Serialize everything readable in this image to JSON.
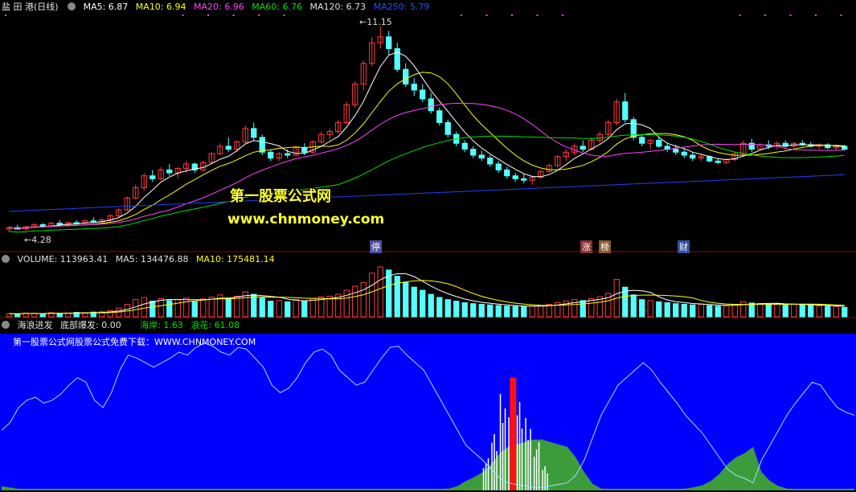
{
  "price_header": {
    "stock": "盐 田 港(日线)",
    "ma5": "MA5: 6.87",
    "ma10": "MA10: 6.94",
    "ma20": "MA20: 6.96",
    "ma60": "MA60: 6.76",
    "ma120": "MA120: 6.73",
    "ma250": "MA250: 5.79"
  },
  "price_labels": {
    "high": "11.15",
    "low": "4.28"
  },
  "event_tags": [
    "停",
    "涨",
    "榜",
    "财"
  ],
  "watermark": {
    "name": "第一股票公式网",
    "url": "www.chnmoney.com"
  },
  "volume_header": {
    "volume": "VOLUME: 113963.41",
    "ma5": "MA5: 134476.88",
    "ma10": "MA10: 175481.14"
  },
  "indicator_header": {
    "name": "海浪进发",
    "bottom": "底部爆发: 0.00",
    "coast": "海岸: 1.63",
    "wave": "浪花: 61.08"
  },
  "indicator_banner": "第一股票公式网股票公式免费下载：WWW.CHNMONEY.COM",
  "colors": {
    "up": "#ff3c3c",
    "down": "#54ffff",
    "ma5": "#ffffff",
    "ma10": "#ffff00",
    "ma20": "#ff40ff",
    "ma60": "#00e000",
    "ma250": "#2040ff",
    "ind_bg": "#0000ff",
    "wave": "#3c9c3c",
    "bottom": "#ff1010"
  },
  "chart_data": [
    {
      "type": "candlestick",
      "series": "daily price",
      "ylim": [
        4.0,
        11.5
      ],
      "high_marker": 11.15,
      "low_marker": 4.28,
      "ohlc": [
        [
          4.3,
          4.4,
          4.2,
          4.35
        ],
        [
          4.35,
          4.45,
          4.28,
          4.3
        ],
        [
          4.3,
          4.4,
          4.25,
          4.38
        ],
        [
          4.38,
          4.5,
          4.3,
          4.45
        ],
        [
          4.45,
          4.5,
          4.35,
          4.4
        ],
        [
          4.4,
          4.55,
          4.35,
          4.5
        ],
        [
          4.5,
          4.6,
          4.4,
          4.45
        ],
        [
          4.45,
          4.55,
          4.38,
          4.52
        ],
        [
          4.52,
          4.6,
          4.45,
          4.5
        ],
        [
          4.5,
          4.62,
          4.45,
          4.58
        ],
        [
          4.58,
          4.7,
          4.5,
          4.55
        ],
        [
          4.55,
          4.65,
          4.5,
          4.62
        ],
        [
          4.62,
          4.8,
          4.55,
          4.75
        ],
        [
          4.75,
          5.0,
          4.7,
          4.95
        ],
        [
          4.95,
          5.4,
          4.9,
          5.35
        ],
        [
          5.35,
          5.8,
          5.3,
          5.7
        ],
        [
          5.7,
          6.2,
          5.6,
          6.1
        ],
        [
          6.1,
          6.3,
          5.9,
          6.0
        ],
        [
          6.0,
          6.4,
          5.95,
          6.3
        ],
        [
          6.3,
          6.5,
          6.1,
          6.2
        ],
        [
          6.2,
          6.4,
          6.0,
          6.35
        ],
        [
          6.35,
          6.6,
          6.2,
          6.5
        ],
        [
          6.5,
          6.55,
          6.2,
          6.3
        ],
        [
          6.3,
          6.6,
          6.25,
          6.55
        ],
        [
          6.55,
          6.9,
          6.5,
          6.85
        ],
        [
          6.85,
          7.2,
          6.8,
          7.1
        ],
        [
          7.1,
          7.4,
          6.9,
          7.0
        ],
        [
          7.0,
          7.3,
          6.9,
          7.25
        ],
        [
          7.25,
          7.8,
          7.2,
          7.7
        ],
        [
          7.7,
          7.9,
          7.3,
          7.4
        ],
        [
          7.4,
          7.5,
          6.8,
          6.9
        ],
        [
          6.9,
          7.0,
          6.6,
          6.7
        ],
        [
          6.7,
          6.9,
          6.6,
          6.85
        ],
        [
          6.85,
          7.0,
          6.7,
          6.8
        ],
        [
          6.8,
          7.1,
          6.75,
          7.05
        ],
        [
          7.05,
          7.2,
          6.8,
          6.9
        ],
        [
          6.9,
          7.3,
          6.85,
          7.25
        ],
        [
          7.25,
          7.6,
          7.2,
          7.5
        ],
        [
          7.5,
          7.7,
          7.3,
          7.6
        ],
        [
          7.6,
          8.0,
          7.5,
          7.9
        ],
        [
          7.9,
          8.6,
          7.85,
          8.5
        ],
        [
          8.5,
          9.3,
          8.4,
          9.2
        ],
        [
          9.2,
          10.0,
          9.0,
          9.9
        ],
        [
          9.9,
          10.8,
          9.8,
          10.6
        ],
        [
          10.6,
          11.15,
          10.4,
          10.8
        ],
        [
          10.8,
          11.0,
          10.2,
          10.4
        ],
        [
          10.4,
          10.6,
          9.6,
          9.7
        ],
        [
          9.7,
          9.9,
          9.1,
          9.2
        ],
        [
          9.2,
          9.4,
          8.8,
          9.0
        ],
        [
          9.0,
          9.2,
          8.6,
          8.7
        ],
        [
          8.7,
          8.9,
          8.2,
          8.3
        ],
        [
          8.3,
          8.4,
          7.8,
          7.9
        ],
        [
          7.9,
          8.0,
          7.4,
          7.5
        ],
        [
          7.5,
          7.6,
          7.1,
          7.2
        ],
        [
          7.2,
          7.3,
          6.9,
          7.0
        ],
        [
          7.0,
          7.1,
          6.7,
          6.8
        ],
        [
          6.8,
          6.95,
          6.6,
          6.7
        ],
        [
          6.7,
          6.8,
          6.4,
          6.5
        ],
        [
          6.5,
          6.6,
          6.2,
          6.3
        ],
        [
          6.3,
          6.4,
          6.0,
          6.1
        ],
        [
          6.1,
          6.2,
          5.9,
          6.0
        ],
        [
          6.0,
          6.15,
          5.85,
          5.95
        ],
        [
          5.95,
          6.1,
          5.8,
          6.05
        ],
        [
          6.05,
          6.3,
          6.0,
          6.25
        ],
        [
          6.25,
          6.5,
          6.2,
          6.45
        ],
        [
          6.45,
          6.8,
          6.4,
          6.75
        ],
        [
          6.75,
          7.0,
          6.6,
          6.9
        ],
        [
          6.9,
          7.2,
          6.8,
          7.1
        ],
        [
          7.1,
          7.3,
          6.9,
          7.0
        ],
        [
          7.0,
          7.4,
          6.95,
          7.3
        ],
        [
          7.3,
          7.6,
          7.2,
          7.5
        ],
        [
          7.5,
          8.0,
          7.4,
          7.9
        ],
        [
          7.9,
          8.7,
          7.8,
          8.6
        ],
        [
          8.6,
          8.9,
          7.9,
          8.0
        ],
        [
          8.0,
          8.1,
          7.3,
          7.4
        ],
        [
          7.4,
          7.5,
          7.1,
          7.2
        ],
        [
          7.2,
          7.35,
          7.0,
          7.3
        ],
        [
          7.3,
          7.4,
          7.05,
          7.1
        ],
        [
          7.1,
          7.2,
          6.9,
          7.0
        ],
        [
          7.0,
          7.15,
          6.8,
          6.9
        ],
        [
          6.9,
          7.0,
          6.7,
          6.8
        ],
        [
          6.8,
          6.9,
          6.6,
          6.7
        ],
        [
          6.7,
          6.85,
          6.6,
          6.75
        ],
        [
          6.75,
          6.8,
          6.55,
          6.6
        ],
        [
          6.6,
          6.7,
          6.5,
          6.55
        ],
        [
          6.55,
          6.7,
          6.5,
          6.65
        ],
        [
          6.65,
          6.9,
          6.6,
          6.85
        ],
        [
          6.85,
          7.3,
          6.8,
          7.2
        ],
        [
          7.2,
          7.35,
          6.9,
          7.0
        ],
        [
          7.0,
          7.2,
          6.95,
          7.15
        ],
        [
          7.15,
          7.3,
          7.0,
          7.1
        ],
        [
          7.1,
          7.25,
          7.0,
          7.2
        ],
        [
          7.2,
          7.3,
          7.05,
          7.1
        ],
        [
          7.1,
          7.25,
          7.0,
          7.2
        ],
        [
          7.2,
          7.3,
          7.1,
          7.15
        ],
        [
          7.15,
          7.25,
          7.05,
          7.1
        ],
        [
          7.1,
          7.2,
          7.0,
          7.15
        ],
        [
          7.15,
          7.2,
          7.0,
          7.05
        ],
        [
          7.05,
          7.15,
          6.95,
          7.1
        ],
        [
          7.1,
          7.15,
          6.95,
          7.0
        ]
      ]
    },
    {
      "type": "bar",
      "series": "VOLUME",
      "values": [
        10,
        9,
        12,
        11,
        10,
        13,
        11,
        12,
        14,
        13,
        15,
        16,
        20,
        28,
        40,
        55,
        62,
        50,
        58,
        52,
        55,
        60,
        48,
        57,
        63,
        70,
        60,
        66,
        80,
        72,
        60,
        50,
        52,
        48,
        56,
        50,
        58,
        64,
        66,
        72,
        85,
        98,
        110,
        140,
        160,
        150,
        130,
        110,
        95,
        85,
        72,
        62,
        55,
        50,
        45,
        42,
        40,
        38,
        36,
        34,
        33,
        32,
        34,
        36,
        40,
        46,
        50,
        55,
        52,
        58,
        64,
        75,
        120,
        95,
        70,
        55,
        52,
        48,
        45,
        42,
        40,
        38,
        40,
        36,
        34,
        35,
        40,
        48,
        44,
        42,
        40,
        42,
        38,
        40,
        38,
        36,
        35,
        34,
        33,
        30
      ]
    },
    {
      "type": "area",
      "series": "海浪进发",
      "wave_line": [
        40,
        45,
        55,
        60,
        62,
        58,
        60,
        64,
        70,
        75,
        72,
        60,
        55,
        65,
        80,
        90,
        88,
        85,
        82,
        85,
        88,
        92,
        90,
        95,
        98,
        96,
        92,
        90,
        95,
        94,
        88,
        82,
        70,
        65,
        68,
        75,
        85,
        92,
        94,
        90,
        80,
        75,
        70,
        72,
        80,
        88,
        95,
        96,
        90,
        85,
        80,
        70,
        60,
        50,
        40,
        30,
        25,
        20,
        14,
        8,
        5,
        4,
        3,
        2,
        2,
        3,
        4,
        5,
        10,
        20,
        35,
        50,
        60,
        70,
        75,
        80,
        85,
        80,
        72,
        65,
        58,
        50,
        44,
        38,
        30,
        22,
        14,
        10,
        8,
        5,
        20,
        30,
        40,
        50,
        58,
        65,
        72,
        70,
        62,
        55,
        52,
        50
      ]
    }
  ]
}
